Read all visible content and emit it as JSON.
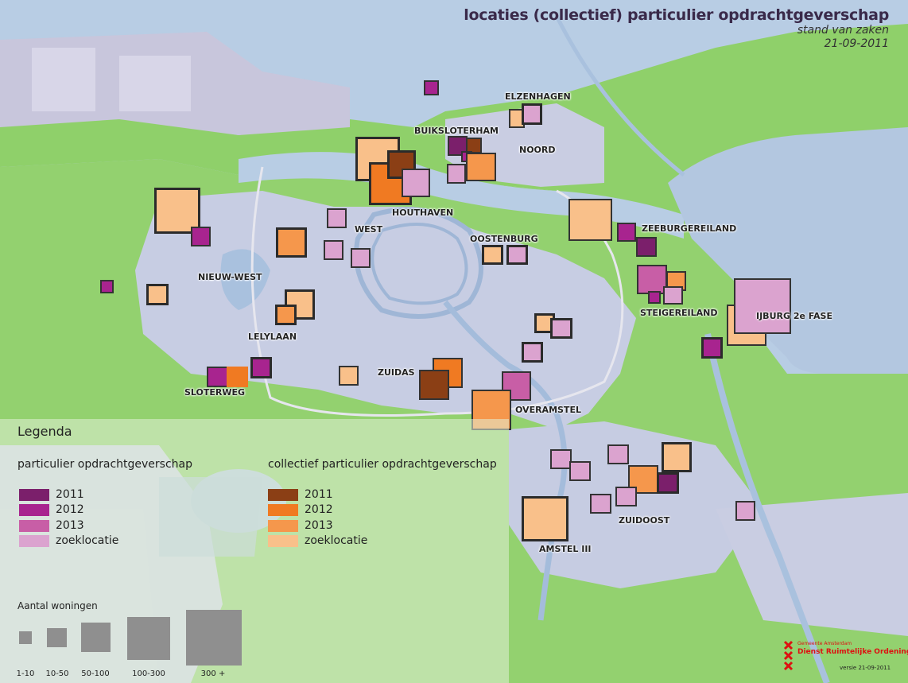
{
  "title": "locaties (collectief) particulier opdrachtgeverschap",
  "subtitle": "stand van zaken",
  "date": "21-09-2011",
  "places": {
    "elzenhagen": "ELZENHAGEN",
    "buiksloterham": "BUIKSLOTERHAM",
    "noord": "NOORD",
    "houthaven": "HOUTHAVEN",
    "zeeburgereiland": "ZEEBURGEREILAND",
    "west": "WEST",
    "oostenburg": "OOSTENBURG",
    "nieuw_west": "NIEUW-WEST",
    "steigereiland": "STEIGEREILAND",
    "ijburg": "IJBURG 2e FASE",
    "lelylaan": "LELYLAAN",
    "zuidas": "ZUIDAS",
    "sloterweg": "SLOTERWEG",
    "overamstel": "OVERAMSTEL",
    "zuidoost": "ZUIDOOST",
    "amstel3": "AMSTEL III"
  },
  "legend": {
    "title": "Legenda",
    "individual": {
      "heading": "particulier opdrachtgeverschap",
      "items": [
        {
          "label": "2011",
          "color": "#7b1f6b"
        },
        {
          "label": "2012",
          "color": "#a8248f"
        },
        {
          "label": "2013",
          "color": "#c85ea6"
        },
        {
          "label": "zoeklocatie",
          "color": "#dba3cf"
        }
      ]
    },
    "collective": {
      "heading": "collectief particulier opdrachtgeverschap",
      "items": [
        {
          "label": "2011",
          "color": "#8b3f15"
        },
        {
          "label": "2012",
          "color": "#f07a22"
        },
        {
          "label": "2013",
          "color": "#f5974c"
        },
        {
          "label": "zoeklocatie",
          "color": "#f9c08a"
        }
      ]
    },
    "sizes": {
      "title": "Aantal woningen",
      "items": [
        "1-10",
        "10-50",
        "50-100",
        "100-300",
        "300 +"
      ]
    }
  },
  "logo": {
    "line1": "Gemeente Amsterdam",
    "line2": "Dienst Ruimtelijke Ordening",
    "version": "versie 21-09-2011"
  }
}
